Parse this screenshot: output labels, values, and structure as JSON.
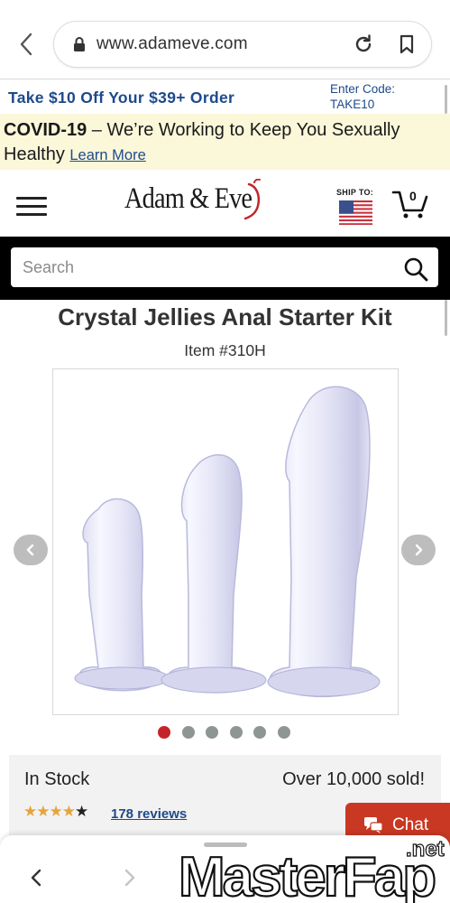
{
  "browser": {
    "url": "www.adameve.com"
  },
  "promo": {
    "offer": "Take $10 Off Your $39+ Order",
    "code_label": "Enter Code:",
    "code": "TAKE10"
  },
  "covid": {
    "heading": "COVID-19",
    "message": " – We’re Working to Keep You Sexually Healthy ",
    "link": "Learn More"
  },
  "header": {
    "logo": "Adam & Eve",
    "ship_to": "SHIP TO:",
    "cart_count": "0"
  },
  "search": {
    "placeholder": "Search"
  },
  "product": {
    "title": "Crystal Jellies Anal Starter Kit",
    "item_number": "Item #310H",
    "gallery_dots": 6,
    "active_image": 1,
    "stock_status": "In Stock",
    "sold_count": "Over 10,000 sold!",
    "rating": 4.5,
    "stars": "★★★★",
    "last_star": "★",
    "reviews": "178 reviews"
  },
  "chat": {
    "label": "Chat"
  },
  "watermark": {
    "main": "MasterFap",
    "suffix": ".net"
  },
  "colors": {
    "brand_blue": "#1d4a8c",
    "chat_red": "#c93823",
    "covid_bg": "#fbf7d9",
    "active_dot": "#c4252a"
  }
}
